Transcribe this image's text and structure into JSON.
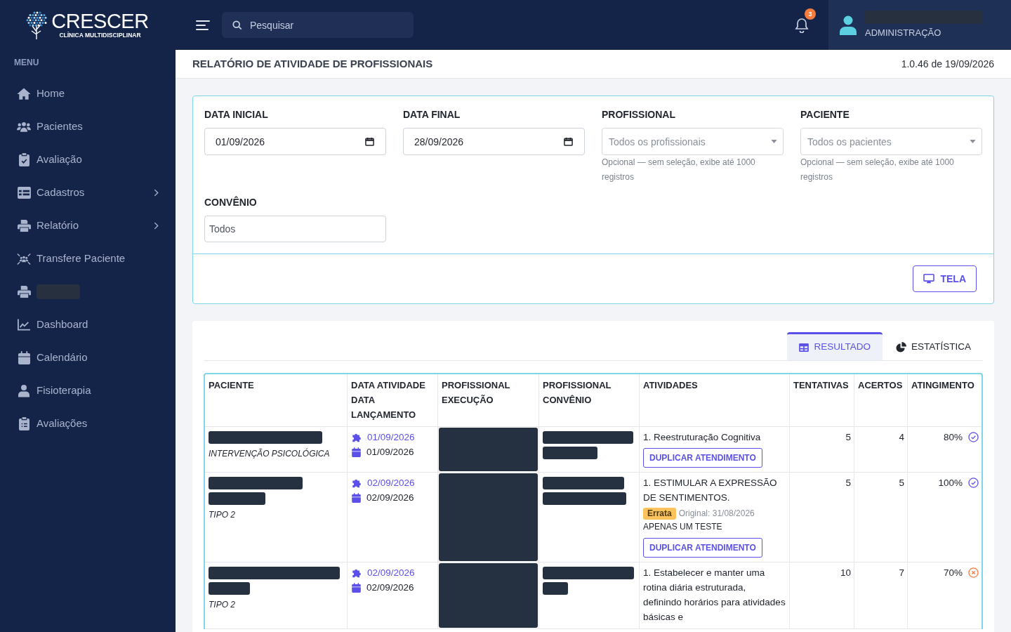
{
  "sidebar": {
    "logo": {
      "title": "CRESCER",
      "subtitle": "CLÍNICA MULTIDISCIPLINAR"
    },
    "section_label": "MENU",
    "items": [
      {
        "kind": "link",
        "label": "Home",
        "has_submenu": false
      },
      {
        "kind": "link",
        "label": "Pacientes",
        "has_submenu": false
      },
      {
        "kind": "link",
        "label": "Avaliação",
        "has_submenu": false
      },
      {
        "kind": "link",
        "label": "Cadastros",
        "has_submenu": true
      },
      {
        "kind": "link",
        "label": "Relatório",
        "has_submenu": true
      },
      {
        "kind": "link",
        "label": "Transfere Paciente",
        "has_submenu": false
      },
      {
        "kind": "redacted",
        "has_submenu": false
      },
      {
        "kind": "link",
        "label": "Dashboard",
        "has_submenu": false
      },
      {
        "kind": "link",
        "label": "Calendário",
        "has_submenu": false
      },
      {
        "kind": "link",
        "label": "Fisioterapia",
        "has_submenu": false
      },
      {
        "kind": "link",
        "label": "Avaliações",
        "has_submenu": false
      }
    ]
  },
  "topbar": {
    "search": {
      "placeholder": "Pesquisar"
    },
    "notifications": {
      "count": "3"
    },
    "user": {
      "name": {
        "kind": "redacted"
      },
      "role": "ADMINISTRAÇÃO"
    }
  },
  "page": {
    "title": "RELATÓRIO DE ATIVIDADE DE PROFISSIONAIS",
    "version": "1.0.46 de 19/09/2026"
  },
  "filters": {
    "fields": [
      {
        "kind": "date",
        "label": "DATA INICIAL",
        "value": "01/09/2026"
      },
      {
        "kind": "date",
        "label": "DATA FINAL",
        "value": "28/09/2026"
      },
      {
        "kind": "select",
        "label": "PROFISSIONAL",
        "placeholder": "Todos os profissionais",
        "help": "Opcional — sem seleção, exibe até 1000 registros"
      },
      {
        "kind": "select",
        "label": "PACIENTE",
        "placeholder": "Todos os pacientes",
        "help": "Opcional — sem seleção, exibe até 1000 registros"
      },
      {
        "kind": "text",
        "label": "CONVÊNIO",
        "value": "Todos"
      }
    ],
    "actions": [
      {
        "label": "TELA"
      }
    ]
  },
  "results": {
    "tabs": [
      {
        "label": "RESULTADO",
        "selected": true
      },
      {
        "label": "ESTATÍSTICA",
        "selected": false
      }
    ],
    "table": {
      "columns": [
        "PACIENTE",
        "DATA ATIVIDADE DATA LANÇAMENTO",
        "PROFISSIONAL EXECUÇÃO",
        "PROFISSIONAL CONVÊNIO",
        "ATIVIDADES",
        "TENTATIVAS",
        "ACERTOS",
        "ATINGIMENTO"
      ],
      "rows": [
        {
          "patient": {
            "name": [
              {
                "kind": "redacted"
              }
            ],
            "type": "INTERVENÇÃO PSICOLÓGICA"
          },
          "activity_date": "01/09/2026",
          "entry_date": "01/09/2026",
          "professional_execution": {
            "kind": "redacted"
          },
          "professional_insurance": [
            {
              "kind": "redacted"
            },
            {
              "kind": "redacted"
            }
          ],
          "activities": [
            "1. Reestruturação Cognitiva"
          ],
          "action": "DUPLICAR ATENDIMENTO",
          "attempts": "5",
          "hits": "4",
          "achievement": "80%",
          "met": true
        },
        {
          "patient": {
            "name": [
              {
                "kind": "redacted"
              },
              {
                "kind": "redacted"
              }
            ],
            "type": "TIPO 2"
          },
          "activity_date": "02/09/2026",
          "entry_date": "02/09/2026",
          "professional_execution": {
            "kind": "redacted"
          },
          "professional_insurance": [
            {
              "kind": "redacted"
            },
            {
              "kind": "redacted"
            }
          ],
          "activities": [
            "1. ESTIMULAR A EXPRESSÃO DE SENTIMENTOS."
          ],
          "errata": {
            "badge": "Errata",
            "original": "Original: 31/08/2026",
            "note": "APENAS UM TESTE"
          },
          "action": "DUPLICAR ATENDIMENTO",
          "attempts": "5",
          "hits": "5",
          "achievement": "100%",
          "met": true
        },
        {
          "patient": {
            "name": [
              {
                "kind": "redacted"
              },
              {
                "kind": "redacted"
              }
            ],
            "type": "TIPO 2"
          },
          "activity_date": "02/09/2026",
          "entry_date": "02/09/2026",
          "professional_execution": {
            "kind": "redacted"
          },
          "professional_insurance": [
            {
              "kind": "redacted"
            },
            {
              "kind": "redacted"
            }
          ],
          "activities": [
            "1. Estabelecer e manter uma rotina diária estruturada, definindo horários para atividades básicas e"
          ],
          "attempts": "10",
          "hits": "7",
          "achievement": "70%",
          "met": false
        }
      ]
    }
  }
}
